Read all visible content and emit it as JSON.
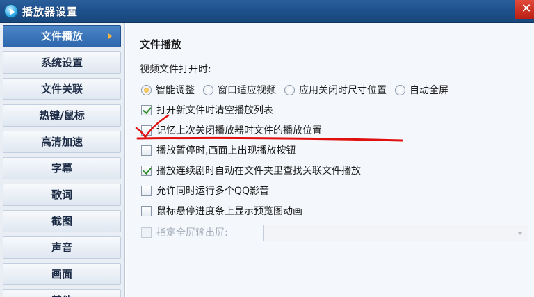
{
  "window": {
    "title": "播放器设置",
    "close_label": "✕"
  },
  "sidebar": {
    "items": [
      {
        "label": "文件播放",
        "active": true
      },
      {
        "label": "系统设置"
      },
      {
        "label": "文件关联"
      },
      {
        "label": "热键/鼠标"
      },
      {
        "label": "高清加速"
      },
      {
        "label": "字幕"
      },
      {
        "label": "歌词"
      },
      {
        "label": "截图"
      },
      {
        "label": "声音"
      },
      {
        "label": "画面"
      },
      {
        "label": "其他"
      }
    ]
  },
  "main": {
    "section_title": "文件播放",
    "open_label": "视频文件打开时:",
    "radios": [
      {
        "label": "智能调整",
        "checked": true
      },
      {
        "label": "窗口适应视频",
        "checked": false
      },
      {
        "label": "应用关闭时尺寸位置",
        "checked": false
      },
      {
        "label": "自动全屏",
        "checked": false
      }
    ],
    "checks": [
      {
        "label": "打开新文件时清空播放列表",
        "checked": true
      },
      {
        "label": "记忆上次关闭播放器时文件的播放位置",
        "checked": false
      },
      {
        "label": "播放暂停时,画面上出现播放按钮",
        "checked": false
      },
      {
        "label": "播放连续剧时自动在文件夹里查找关联文件播放",
        "checked": true
      },
      {
        "label": "允许同时运行多个QQ影音",
        "checked": false
      },
      {
        "label": "鼠标悬停进度条上显示预览图动画",
        "checked": false
      },
      {
        "label": "指定全屏输出屏:",
        "checked": false,
        "disabled": true
      }
    ],
    "output_screen_value": ""
  },
  "colors": {
    "titlebar": "#1d4f8a",
    "active_nav": "#2e67ad",
    "annotation": "#e01010"
  }
}
